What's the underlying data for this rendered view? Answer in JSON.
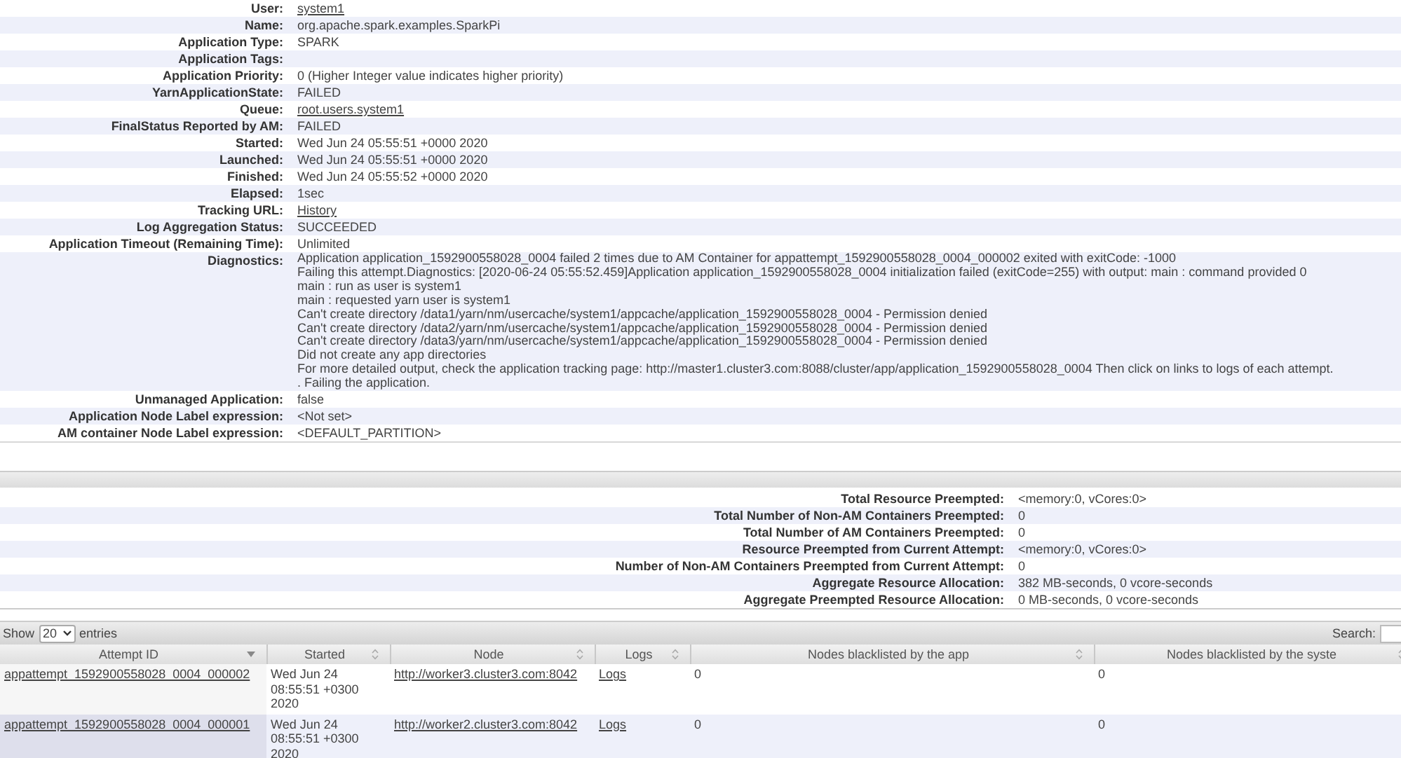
{
  "info": [
    {
      "label": "User:",
      "value": "system1",
      "kind": "link"
    },
    {
      "label": "Name:",
      "value": "org.apache.spark.examples.SparkPi",
      "kind": "text"
    },
    {
      "label": "Application Type:",
      "value": "SPARK",
      "kind": "text"
    },
    {
      "label": "Application Tags:",
      "kind": "text"
    },
    {
      "label": "Application Priority:",
      "value": "0 (Higher Integer value indicates higher priority)",
      "kind": "text"
    },
    {
      "label": "YarnApplicationState:",
      "value": "FAILED",
      "kind": "text"
    },
    {
      "label": "Queue:",
      "value": "root.users.system1",
      "kind": "link"
    },
    {
      "label": "FinalStatus Reported by AM:",
      "value": "FAILED",
      "kind": "text"
    },
    {
      "label": "Started:",
      "value": "Wed Jun 24 05:55:51 +0000 2020",
      "kind": "text"
    },
    {
      "label": "Launched:",
      "value": "Wed Jun 24 05:55:51 +0000 2020",
      "kind": "text"
    },
    {
      "label": "Finished:",
      "value": "Wed Jun 24 05:55:52 +0000 2020",
      "kind": "text"
    },
    {
      "label": "Elapsed:",
      "value": "1sec",
      "kind": "text"
    },
    {
      "label": "Tracking URL:",
      "value": "History",
      "kind": "link"
    },
    {
      "label": "Log Aggregation Status:",
      "value": "SUCCEEDED",
      "kind": "text"
    },
    {
      "label": "Application Timeout (Remaining Time):",
      "value": "Unlimited",
      "kind": "text"
    },
    {
      "label": "Diagnostics:",
      "kind": "lines",
      "lines": [
        "Application application_1592900558028_0004 failed 2 times due to AM Container for appattempt_1592900558028_0004_000002 exited with exitCode: -1000",
        "Failing this attempt.Diagnostics: [2020-06-24 05:55:52.459]Application application_1592900558028_0004 initialization failed (exitCode=255) with output: main : command provided 0",
        "main : run as user is system1",
        "main : requested yarn user is system1",
        "Can't create directory /data1/yarn/nm/usercache/system1/appcache/application_1592900558028_0004 - Permission denied",
        "Can't create directory /data2/yarn/nm/usercache/system1/appcache/application_1592900558028_0004 - Permission denied",
        "Can't create directory /data3/yarn/nm/usercache/system1/appcache/application_1592900558028_0004 - Permission denied",
        "Did not create any app directories",
        "For more detailed output, check the application tracking page: http://master1.cluster3.com:8088/cluster/app/application_1592900558028_0004 Then click on links to logs of each attempt.",
        ". Failing the application."
      ]
    },
    {
      "label": "Unmanaged Application:",
      "value": "false",
      "kind": "text"
    },
    {
      "label": "Application Node Label expression:",
      "value": "<Not set>",
      "kind": "text"
    },
    {
      "label": "AM container Node Label expression:",
      "value": "<DEFAULT_PARTITION>",
      "kind": "text"
    }
  ],
  "preemption": [
    {
      "label": "Total Resource Preempted:",
      "value": "<memory:0, vCores:0>"
    },
    {
      "label": "Total Number of Non-AM Containers Preempted:",
      "value": "0"
    },
    {
      "label": "Total Number of AM Containers Preempted:",
      "value": "0"
    },
    {
      "label": "Resource Preempted from Current Attempt:",
      "value": "<memory:0, vCores:0>"
    },
    {
      "label": "Number of Non-AM Containers Preempted from Current Attempt:",
      "value": "0"
    },
    {
      "label": "Aggregate Resource Allocation:",
      "value": "382 MB-seconds, 0 vcore-seconds"
    },
    {
      "label": "Aggregate Preempted Resource Allocation:",
      "value": "0 MB-seconds, 0 vcore-seconds"
    }
  ],
  "attempts": {
    "show_label": "Show",
    "page_size": "20",
    "entries_label": "entries",
    "search_label": "Search:",
    "columns": [
      {
        "label": "Attempt ID",
        "sorted": true
      },
      {
        "label": "Started",
        "sorted": false
      },
      {
        "label": "Node",
        "sorted": false
      },
      {
        "label": "Logs",
        "sorted": false
      },
      {
        "label": "Nodes blacklisted by the app",
        "sorted": false
      },
      {
        "label": "Nodes blacklisted by the syste",
        "sorted": false
      }
    ],
    "rows": [
      {
        "attempt_id": "appattempt_1592900558028_0004_000002",
        "started": "Wed Jun 24 08:55:51 +0300 2020",
        "node": "http://worker3.cluster3.com:8042",
        "logs": "Logs",
        "blacklisted_app": "0",
        "blacklisted_system": "0"
      },
      {
        "attempt_id": "appattempt_1592900558028_0004_000001",
        "started": "Wed Jun 24 08:55:51 +0300 2020",
        "node": "http://worker2.cluster3.com:8042",
        "logs": "Logs",
        "blacklisted_app": "0",
        "blacklisted_system": "0"
      }
    ]
  }
}
